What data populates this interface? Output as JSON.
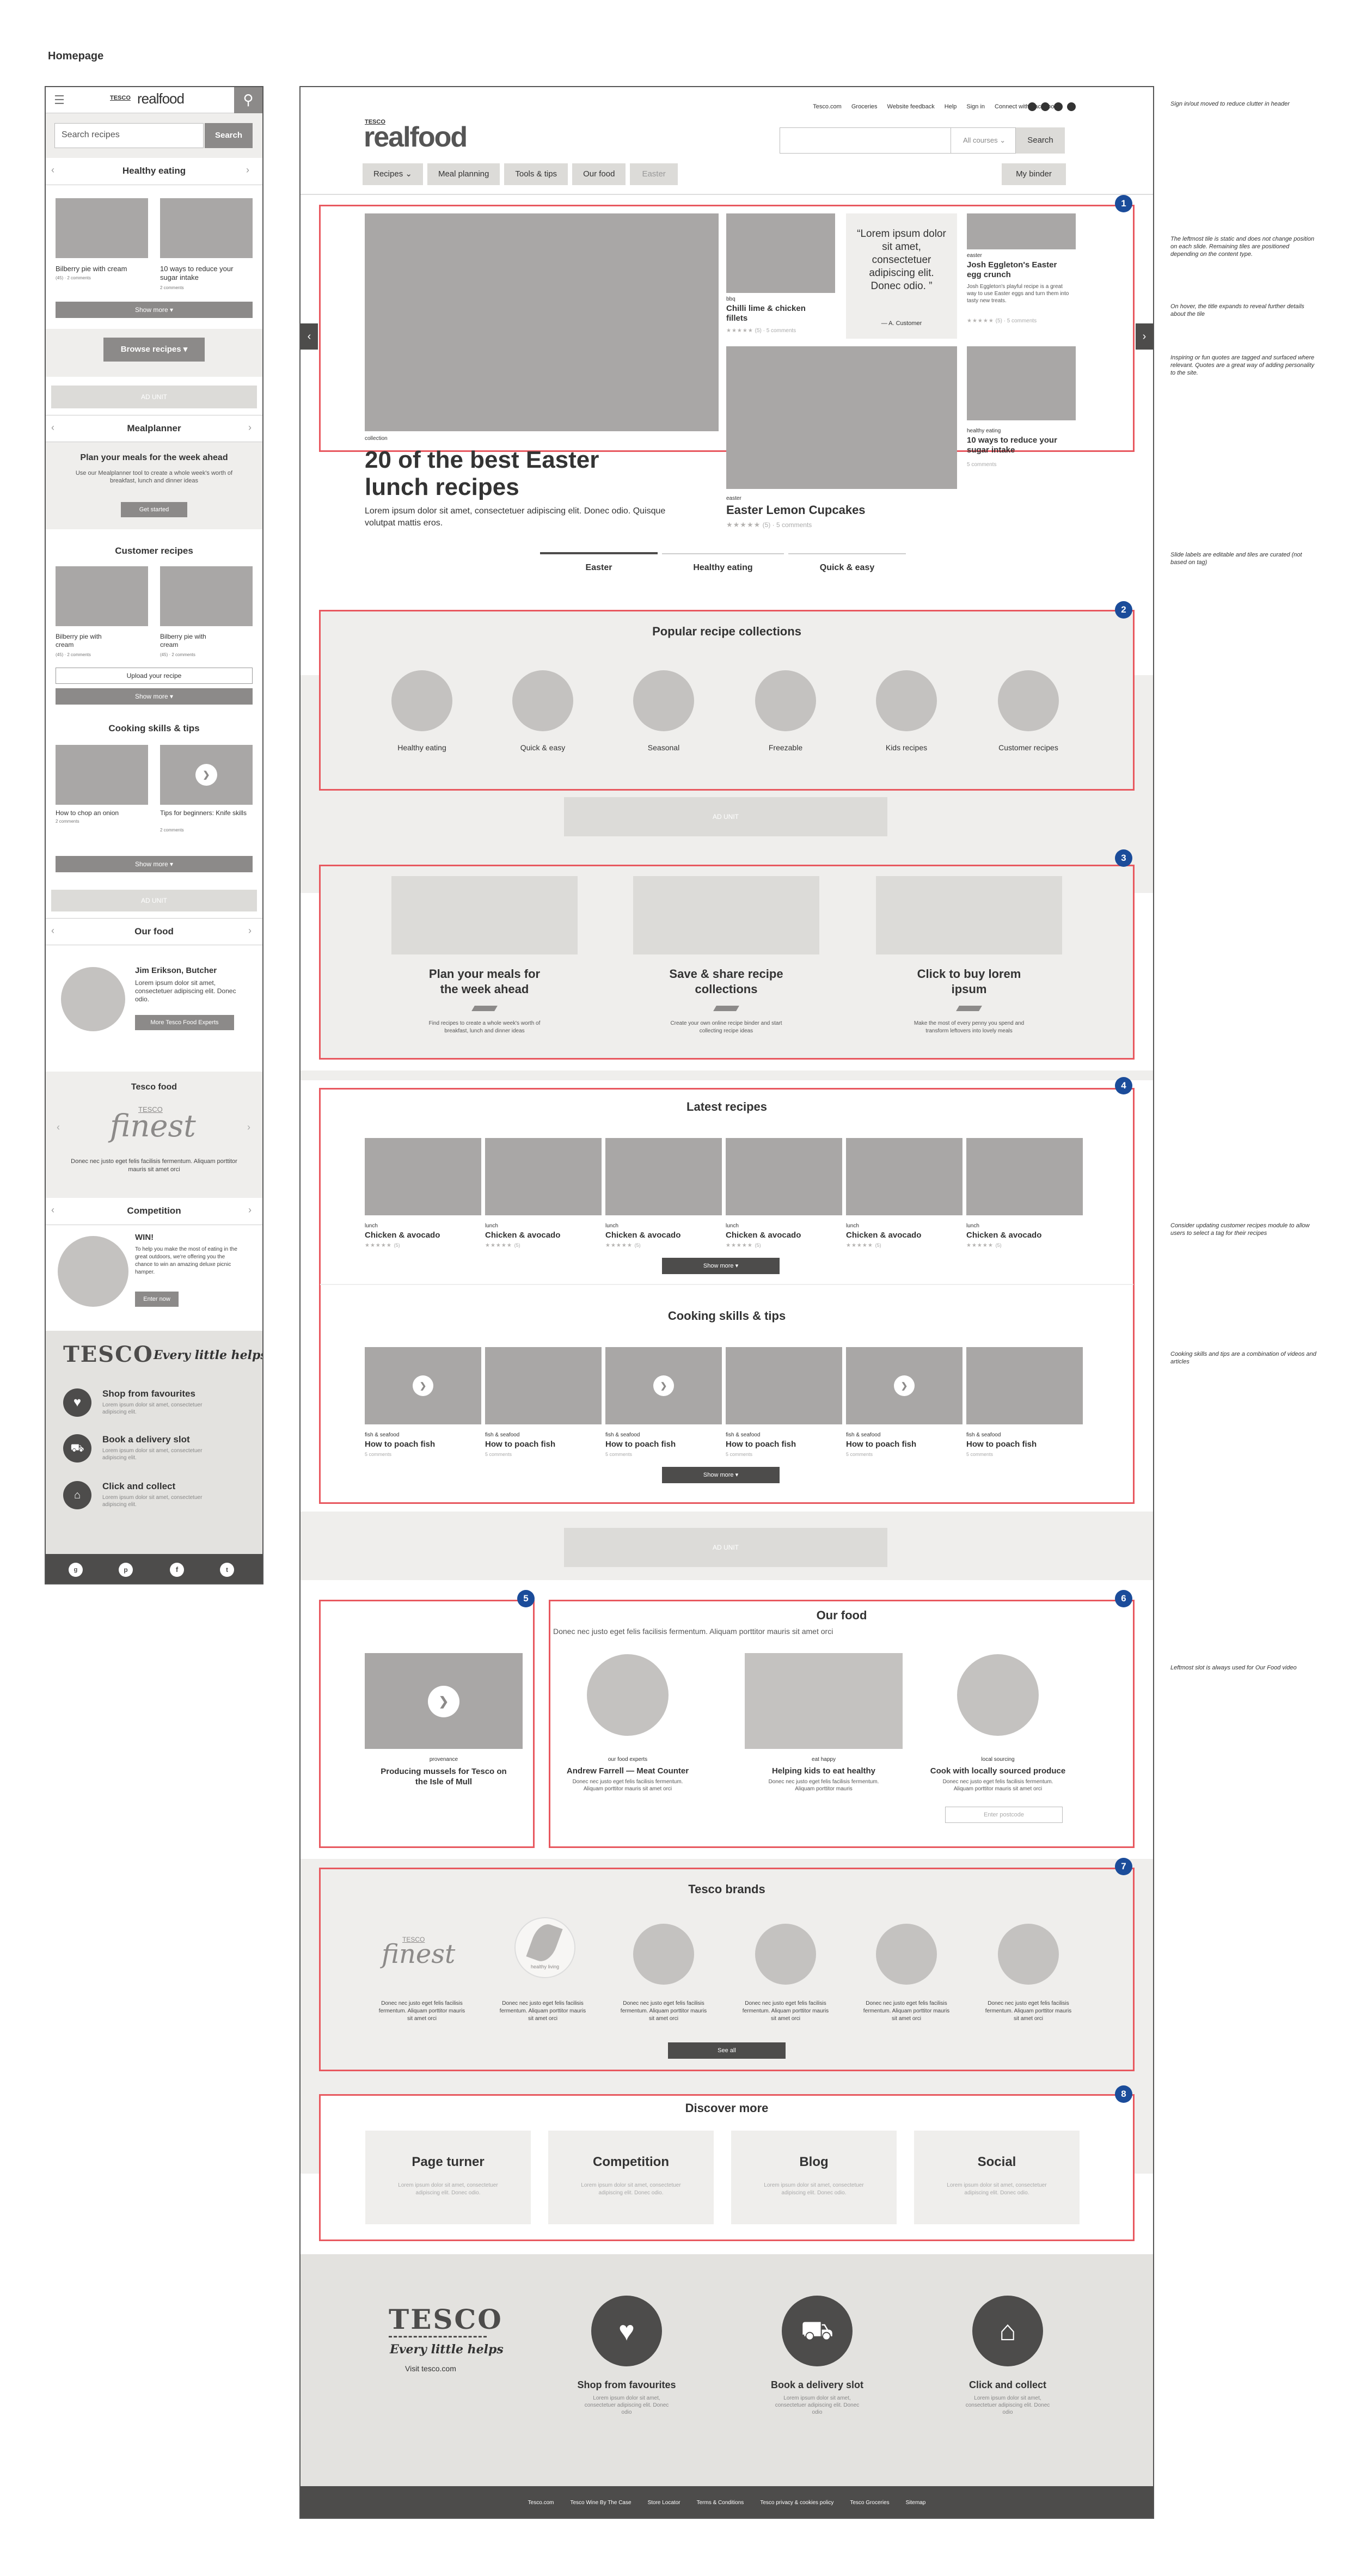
{
  "page_title": "Homepage",
  "mobile": {
    "logo": "realfood",
    "logo_small": "TESCO",
    "search_placeholder": "Search recipes",
    "search_button": "Search",
    "slider_title": "Healthy eating",
    "tiles": [
      {
        "title": "Bilberry pie with cream",
        "meta": "(45) · 2 comments"
      },
      {
        "title": "10 ways to reduce your sugar intake",
        "meta": "2 comments"
      }
    ],
    "show_more": "Show more",
    "browse_recipes": "Browse recipes",
    "ad_unit": "AD UNIT",
    "mealplanner_title": "Mealplanner",
    "plan_heading": "Plan your meals for the week ahead",
    "plan_text": "Use our Mealplanner tool to create a whole week's worth of breakfast, lunch and dinner ideas",
    "get_started": "Get started",
    "customer_recipes_title": "Customer recipes",
    "customer_tiles": [
      {
        "title": "Bilberry pie with cream",
        "meta": "(45) · 2 comments"
      },
      {
        "title": "Bilberry pie with cream",
        "meta": "(45) · 2 comments"
      }
    ],
    "upload_recipe": "Upload your recipe",
    "cooking_title": "Cooking skills & tips",
    "cooking_tiles": [
      {
        "title": "How to chop an onion",
        "meta": "2 comments"
      },
      {
        "title": "Tips for beginners: Knife skills",
        "meta": "2 comments"
      }
    ],
    "our_food_title": "Our food",
    "butcher_name": "Jim Erikson, Butcher",
    "butcher_text": "Lorem ipsum dolor sit amet, consectetuer adipiscing elit. Donec odio.",
    "more_experts": "More Tesco Food Experts",
    "tesco_food_title": "Tesco food",
    "finest_small": "TESCO",
    "finest_logo": "finest",
    "finest_text": "Donec nec justo eget felis facilisis fermentum. Aliquam porttitor mauris sit amet orci",
    "competition_title": "Competition",
    "win_title": "WIN!",
    "win_text": "To help you make the most of eating in the great outdoors, we're offering you the chance to win an amazing deluxe picnic hamper.",
    "enter_now": "Enter now",
    "tesco_logo": "TESCO",
    "tagline": "Every little helps",
    "services": [
      {
        "title": "Shop from favourites",
        "text": "Lorem ipsum dolor sit amet, consectetuer adipiscing elit."
      },
      {
        "title": "Book a delivery slot",
        "text": "Lorem ipsum dolor sit amet, consectetuer adipiscing elit."
      },
      {
        "title": "Click and collect",
        "text": "Lorem ipsum dolor sit amet, consectetuer adipiscing elit."
      }
    ]
  },
  "desktop": {
    "top_links": [
      "Tesco.com",
      "Groceries",
      "Website feedback",
      "Help",
      "Sign in",
      "Connect with Facebook"
    ],
    "logo_small": "TESCO",
    "logo": "realfood",
    "course_select": "All courses",
    "search_button": "Search",
    "nav": [
      "Recipes",
      "Meal planning",
      "Tools & tips",
      "Our food",
      "Easter"
    ],
    "my_binder": "My binder",
    "hero": {
      "main_tag": "collection",
      "main_title": "20 of the best Easter lunch recipes",
      "main_text": "Lorem ipsum dolor sit amet, consectetuer adipiscing elit. Donec odio. Quisque volutpat mattis eros.",
      "bbq_tag": "bbq",
      "bbq_title": "Chilli lime & chicken fillets",
      "bbq_meta": "(5) · 5 comments",
      "quote": "“Lorem ipsum dolor sit amet, consectetuer adipiscing elit. Donec odio. ”",
      "quote_author": "— A. Customer",
      "easter1_tag": "easter",
      "easter1_title": "Josh Eggleton's Easter egg crunch",
      "easter1_text": "Josh Eggleton's playful recipe is a great way to use Easter eggs and turn them into tasty new treats.",
      "easter1_meta": "(5) · 5 comments",
      "cupcakes_tag": "easter",
      "cupcakes_title": "Easter Lemon Cupcakes",
      "cupcakes_meta": "(5) · 5 comments",
      "sugar_tag": "healthy eating",
      "sugar_title": "10 ways to reduce your sugar intake",
      "sugar_meta": "5 comments",
      "tabs": [
        "Easter",
        "Healthy eating",
        "Quick & easy"
      ]
    },
    "collections_title": "Popular recipe collections",
    "collections": [
      "Healthy eating",
      "Quick & easy",
      "Seasonal",
      "Freezable",
      "Kids recipes",
      "Customer recipes"
    ],
    "ad_unit": "AD UNIT",
    "promos": [
      {
        "title": "Plan your meals for the week ahead",
        "text": "Find recipes to create a whole week's worth of breakfast, lunch and dinner ideas"
      },
      {
        "title": "Save & share recipe collections",
        "text": "Create your own online recipe binder and start collecting recipe ideas"
      },
      {
        "title": "Click to buy lorem ipsum",
        "text": "Make the most of every penny you spend and transform leftovers into lovely meals"
      }
    ],
    "latest_title": "Latest recipes",
    "latest_tag": "lunch",
    "latest_item": "Chicken & avocado",
    "latest_meta": "(5)",
    "show_more": "Show more",
    "cooking_title": "Cooking skills & tips",
    "cooking_tag": "fish & seafood",
    "cooking_item": "How to poach fish",
    "cooking_meta": "5 comments",
    "video_tag": "provenance",
    "video_title": "Producing mussels for Tesco on the Isle of Mull",
    "our_food_title": "Our food",
    "our_food_sub": "Donec nec justo eget felis facilisis fermentum. Aliquam porttitor mauris sit amet orci",
    "experts": [
      {
        "tag": "our food experts",
        "title": "Andrew Farrell — Meat Counter",
        "text": "Donec nec justo eget felis facilisis fermentum. Aliquam porttitor mauris sit amet orci"
      },
      {
        "tag": "eat happy",
        "title": "Helping kids to eat healthy",
        "text": "Donec nec justo eget felis facilisis fermentum. Aliquam porttitor mauris"
      },
      {
        "tag": "local sourcing",
        "title": "Cook with locally sourced produce",
        "text": "Donec nec justo eget felis facilisis fermentum. Aliquam porttitor mauris sit amet orci"
      }
    ],
    "postcode_placeholder": "Enter postcode",
    "brands_title": "Tesco brands",
    "brand_text": "Donec nec justo eget felis facilisis fermentum. Aliquam porttitor mauris sit amet orci",
    "finest_small": "TESCO",
    "finest_logo": "finest",
    "healthy_living": "healthy living",
    "see_all": "See all",
    "discover_title": "Discover more",
    "discover": [
      {
        "title": "Page turner",
        "text": "Lorem ipsum dolor sit amet, consectetuer adipiscing elit. Donec odio."
      },
      {
        "title": "Competition",
        "text": "Lorem ipsum dolor sit amet, consectetuer adipiscing elit. Donec odio."
      },
      {
        "title": "Blog",
        "text": "Lorem ipsum dolor sit amet, consectetuer adipiscing elit. Donec odio."
      },
      {
        "title": "Social",
        "text": "Lorem ipsum dolor sit amet, consectetuer adipiscing elit. Donec odio."
      }
    ],
    "tesco_logo": "TESCO",
    "tagline": "Every little helps",
    "visit": "Visit tesco.com",
    "services": [
      {
        "title": "Shop from favourites",
        "text": "Lorem ipsum dolor sit amet, consectetuer adipiscing elit. Donec odio"
      },
      {
        "title": "Book a delivery slot",
        "text": "Lorem ipsum dolor sit amet, consectetuer adipiscing elit. Donec odio"
      },
      {
        "title": "Click and collect",
        "text": "Lorem ipsum dolor sit amet, consectetuer adipiscing elit. Donec odio"
      }
    ],
    "footer_links": [
      "Tesco.com",
      "Tesco Wine By The Case",
      "Store Locator",
      "Terms & Conditions",
      "Tesco privacy & cookies policy",
      "Tesco Groceries",
      "Sitemap"
    ]
  },
  "annotations": {
    "n1": "Sign in/out moved to reduce clutter in header",
    "n2": "The leftmost tile is static and does not change position on each slide. Remaining tiles are positioned depending on the content type.",
    "n3": "On hover, the title expands to reveal further details about the tile",
    "n4": "Inspiring or fun quotes are tagged and surfaced where relevant. Quotes are a great way of adding personality to the site.",
    "n5": "Slide labels are editable and tiles are curated (not based on tag)",
    "n6": "Consider updating customer recipes module to allow users to select a tag for their recipes",
    "n7": "Cooking skills and tips are a combination of videos and articles",
    "n8": "Leftmost slot is always used for Our Food video"
  },
  "badges": [
    "1",
    "2",
    "3",
    "4",
    "5",
    "6",
    "7",
    "8"
  ],
  "colors": {
    "accent_red": "#e8585f",
    "badge_blue": "#1b4c9a",
    "placeholder": "#a9a7a6",
    "dark": "#4d4c4b"
  }
}
